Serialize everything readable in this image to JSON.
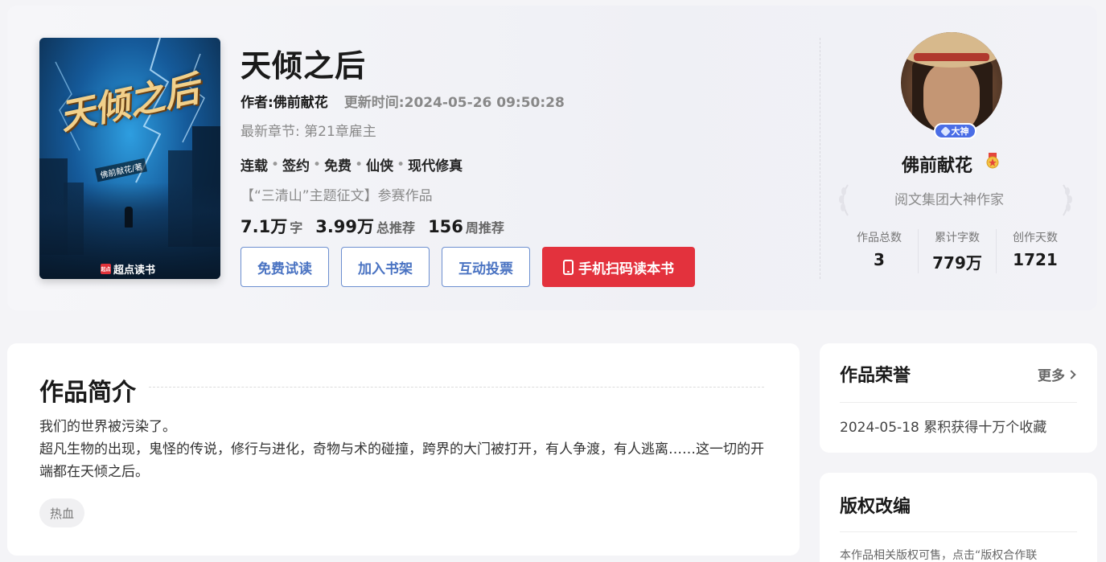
{
  "book": {
    "title": "天倾之后",
    "author_line": "作者:佛前献花",
    "updated_line": "更新时间:2024-05-26 09:50:28",
    "latest_chapter": "最新章节: 第21章雇主",
    "tags": [
      "连载",
      "签约",
      "免费",
      "仙侠",
      "现代修真"
    ],
    "contest": "【“三清山”主题征文】参赛作品",
    "stats": [
      {
        "value": "7.1万",
        "unit": "字"
      },
      {
        "value": "3.99万",
        "unit": "总推荐"
      },
      {
        "value": "156",
        "unit": "周推荐"
      }
    ],
    "cover": {
      "title": "天倾之后",
      "author_tag": "佛前献花/著",
      "brand": "超点读书",
      "brand_logo": "起点"
    }
  },
  "actions": {
    "free_read": "免费试读",
    "add_shelf": "加入书架",
    "vote": "互动投票",
    "scan_read": "手机扫码读本书"
  },
  "author": {
    "badge": "大神",
    "name": "佛前献花",
    "title": "阅文集团大神作家",
    "stats": [
      {
        "label": "作品总数",
        "value": "3"
      },
      {
        "label": "累计字数",
        "value": "779万"
      },
      {
        "label": "创作天数",
        "value": "1721"
      }
    ]
  },
  "intro": {
    "heading": "作品简介",
    "lines": [
      "我们的世界被污染了。",
      "超凡生物的出现，鬼怪的传说，修行与进化，奇物与术的碰撞，跨界的大门被打开，有人争渡，有人逃离……这一切的开端都在天倾之后。"
    ],
    "genre_chip": "热血"
  },
  "honors": {
    "heading": "作品荣誉",
    "more": "更多",
    "item": "2024-05-18 累积获得十万个收藏"
  },
  "copyright": {
    "heading": "版权改编",
    "text": "本作品相关版权可售，点击“版权合作联"
  },
  "colors": {
    "accent_blue": "#4a73c2",
    "accent_red": "#e3323d",
    "badge_blue": "#4b6ee6"
  }
}
